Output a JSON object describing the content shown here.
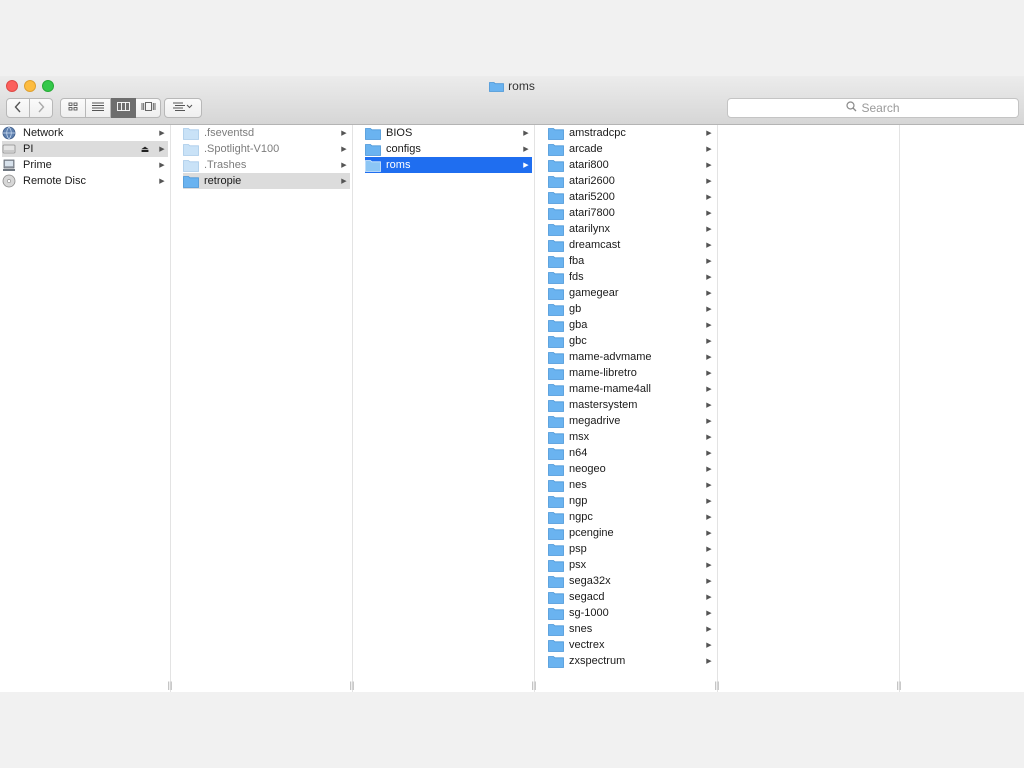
{
  "window": {
    "title": "roms"
  },
  "toolbar": {
    "back_icon": "chevron-left-icon",
    "forward_icon": "chevron-right-icon",
    "views": [
      "icon-view-icon",
      "list-view-icon",
      "column-view-icon",
      "cover-flow-icon"
    ],
    "active_view": "column-view-icon",
    "arrange_icon": "arrange-icon",
    "search_placeholder": "Search"
  },
  "colors": {
    "selection_blue": "#1f6ef0",
    "selection_gray": "#dcdcdc",
    "folder": "#6ab3f0"
  },
  "columns": [
    {
      "items": [
        {
          "label": "Network",
          "icon": "network-globe-icon"
        },
        {
          "label": "PI",
          "icon": "drive-icon",
          "eject": "⏏",
          "selected": "gray"
        },
        {
          "label": "Prime",
          "icon": "server-icon"
        },
        {
          "label": "Remote Disc",
          "icon": "disc-icon"
        }
      ]
    },
    {
      "items": [
        {
          "label": ".fseventsd",
          "dim": true
        },
        {
          "label": ".Spotlight-V100",
          "dim": true
        },
        {
          "label": ".Trashes",
          "dim": true
        },
        {
          "label": "retropie",
          "selected": "gray"
        }
      ]
    },
    {
      "items": [
        {
          "label": "BIOS"
        },
        {
          "label": "configs"
        },
        {
          "label": "roms",
          "selected": "blue"
        }
      ]
    },
    {
      "items": [
        {
          "label": "amstradcpc"
        },
        {
          "label": "arcade"
        },
        {
          "label": "atari800"
        },
        {
          "label": "atari2600"
        },
        {
          "label": "atari5200"
        },
        {
          "label": "atari7800"
        },
        {
          "label": "atarilynx"
        },
        {
          "label": "dreamcast"
        },
        {
          "label": "fba"
        },
        {
          "label": "fds"
        },
        {
          "label": "gamegear"
        },
        {
          "label": "gb"
        },
        {
          "label": "gba"
        },
        {
          "label": "gbc"
        },
        {
          "label": "mame-advmame"
        },
        {
          "label": "mame-libretro"
        },
        {
          "label": "mame-mame4all"
        },
        {
          "label": "mastersystem"
        },
        {
          "label": "megadrive"
        },
        {
          "label": "msx"
        },
        {
          "label": "n64"
        },
        {
          "label": "neogeo"
        },
        {
          "label": "nes"
        },
        {
          "label": "ngp"
        },
        {
          "label": "ngpc"
        },
        {
          "label": "pcengine"
        },
        {
          "label": "psp"
        },
        {
          "label": "psx"
        },
        {
          "label": "sega32x"
        },
        {
          "label": "segacd"
        },
        {
          "label": "sg-1000"
        },
        {
          "label": "snes"
        },
        {
          "label": "vectrex"
        },
        {
          "label": "zxspectrum"
        }
      ]
    }
  ]
}
